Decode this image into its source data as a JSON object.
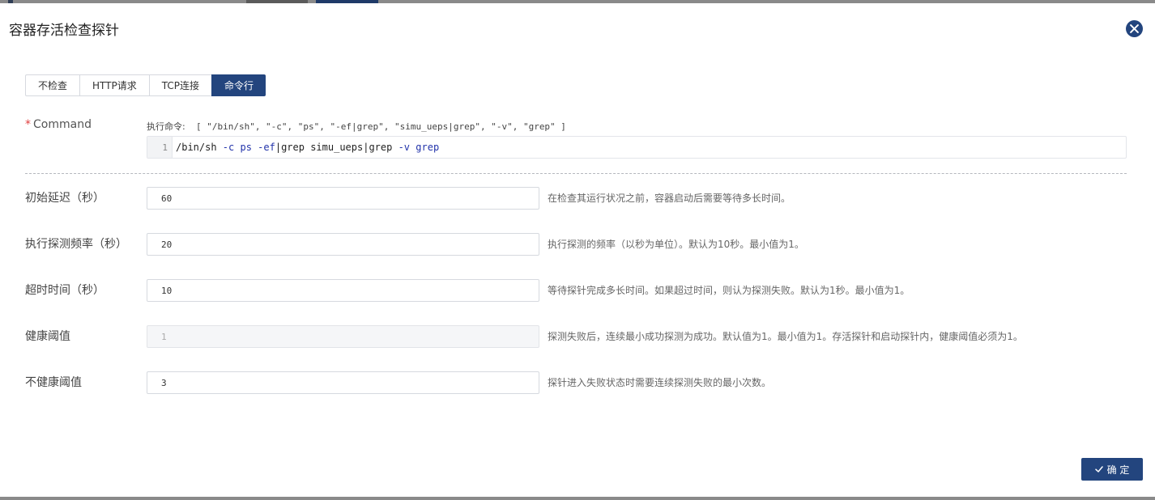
{
  "dialog": {
    "title": "容器存活检查探针",
    "close_icon": "close-icon"
  },
  "tabs": [
    {
      "label": "不检查",
      "active": false
    },
    {
      "label": "HTTP请求",
      "active": false
    },
    {
      "label": "TCP连接",
      "active": false
    },
    {
      "label": "命令行",
      "active": true
    }
  ],
  "command": {
    "required_mark": "*",
    "label": "Command",
    "hint_label": "执行命令:",
    "hint_value": "[ \"/bin/sh\", \"-c\", \"ps\", \"-ef|grep\", \"simu_ueps|grep\", \"-v\", \"grep\" ]",
    "line_number": "1",
    "code_tokens": [
      {
        "text": "/bin/sh ",
        "kw": false
      },
      {
        "text": "-c",
        "kw": true
      },
      {
        "text": " ",
        "kw": false
      },
      {
        "text": "ps",
        "kw": true
      },
      {
        "text": " ",
        "kw": false
      },
      {
        "text": "-ef",
        "kw": true
      },
      {
        "text": "|grep simu_ueps|grep ",
        "kw": false
      },
      {
        "text": "-v",
        "kw": true
      },
      {
        "text": " ",
        "kw": false
      },
      {
        "text": "grep",
        "kw": true
      }
    ]
  },
  "fields": [
    {
      "label": "初始延迟（秒）",
      "value": "60",
      "disabled": false,
      "desc": "在检查其运行状况之前，容器启动后需要等待多长时间。"
    },
    {
      "label": "执行探测频率（秒）",
      "value": "20",
      "disabled": false,
      "desc": "执行探测的频率（以秒为单位）。默认为10秒。最小值为1。"
    },
    {
      "label": "超时时间（秒）",
      "value": "10",
      "disabled": false,
      "desc": "等待探针完成多长时间。如果超过时间，则认为探测失败。默认为1秒。最小值为1。"
    },
    {
      "label": "健康阈值",
      "value": "1",
      "disabled": true,
      "desc": "探测失败后，连续最小成功探测为成功。默认值为1。最小值为1。存活探针和启动探针内，健康阈值必须为1。"
    },
    {
      "label": "不健康阈值",
      "value": "3",
      "disabled": false,
      "desc": "探针进入失败状态时需要连续探测失败的最小次数。"
    }
  ],
  "footer": {
    "ok_label": "确 定",
    "ok_icon": "check-icon"
  },
  "colors": {
    "accent": "#23457e",
    "required": "#e04040"
  }
}
